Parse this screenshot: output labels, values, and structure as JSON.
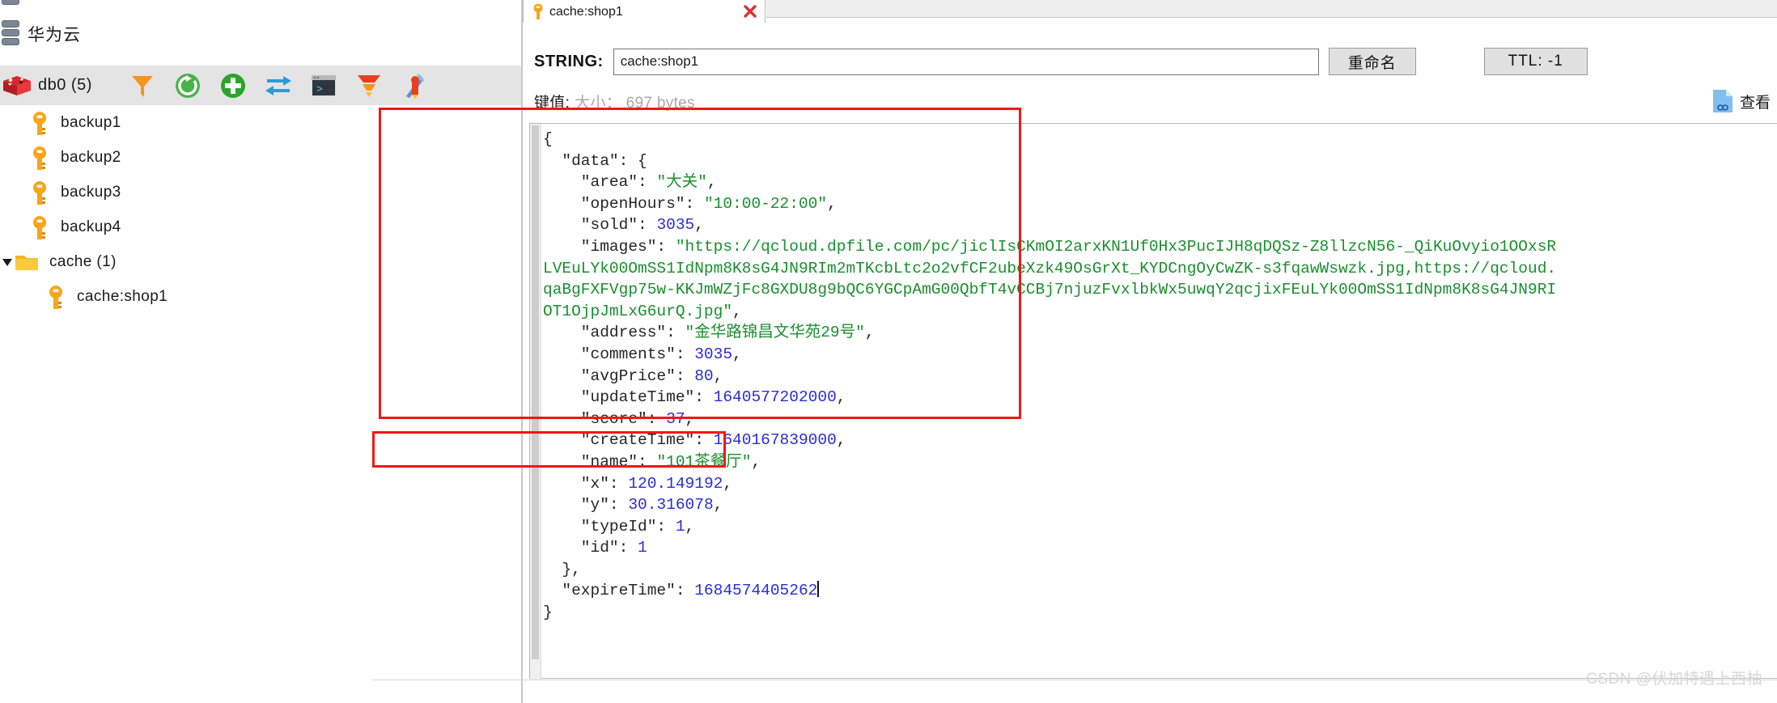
{
  "app": {
    "cloud_title": "华为云",
    "watermark": "CSDN @伏加特遇上西柚"
  },
  "sidebar": {
    "db_label": "db0 (5)",
    "db_icon": "redis-cube-icon",
    "toolbar_icons": [
      {
        "name": "filter-icon",
        "color": "#f7941e"
      },
      {
        "name": "refresh-icon",
        "color": "#3aa93a"
      },
      {
        "name": "add-icon",
        "color": "#2aa52a"
      },
      {
        "name": "switch-db-icon",
        "color": "#2e9bd6"
      },
      {
        "name": "console-icon",
        "color": "#2f3640"
      },
      {
        "name": "flush-icon",
        "color": "#e8401f"
      },
      {
        "name": "tools-icon",
        "color": "#e8401f"
      }
    ],
    "items": [
      {
        "label": "backup1",
        "icon": "key-icon",
        "type": "key",
        "indent": 1,
        "expanded": false
      },
      {
        "label": "backup2",
        "icon": "key-icon",
        "type": "key",
        "indent": 1,
        "expanded": false
      },
      {
        "label": "backup3",
        "icon": "key-icon",
        "type": "key",
        "indent": 1,
        "expanded": false
      },
      {
        "label": "backup4",
        "icon": "key-icon",
        "type": "key",
        "indent": 1,
        "expanded": false
      },
      {
        "label": "cache (1)",
        "icon": "folder-icon",
        "type": "folder",
        "indent": 0,
        "expanded": true
      },
      {
        "label": "cache:shop1",
        "icon": "key-icon",
        "type": "key",
        "indent": 2,
        "expanded": false
      }
    ]
  },
  "tab": {
    "label": "cache:shop1",
    "close_icon": "close-icon",
    "key_icon": "key-icon"
  },
  "toolbar": {
    "type_label": "STRING:",
    "key_value": "cache:shop1",
    "key_placeholder": "key",
    "rename_label": "重命名",
    "ttl_label": "TTL: -1"
  },
  "info": {
    "value_label": "键值:",
    "size_label": "大小： 697 bytes",
    "view_label": "查看",
    "view_icon": "document-link-icon"
  },
  "editor": {
    "caret_visible": true,
    "json_lines": [
      [
        {
          "t": "{",
          "c": "s-key"
        }
      ],
      [
        {
          "t": "  \"data\": {",
          "c": "s-key"
        }
      ],
      [
        {
          "t": "    \"area\": ",
          "c": "s-key"
        },
        {
          "t": "\"大关\"",
          "c": "s-str"
        },
        {
          "t": ",",
          "c": "s-key"
        }
      ],
      [
        {
          "t": "    \"openHours\": ",
          "c": "s-key"
        },
        {
          "t": "\"10:00-22:00\"",
          "c": "s-str"
        },
        {
          "t": ",",
          "c": "s-key"
        }
      ],
      [
        {
          "t": "    \"sold\": ",
          "c": "s-key"
        },
        {
          "t": "3035",
          "c": "s-num"
        },
        {
          "t": ",",
          "c": "s-key"
        }
      ],
      [
        {
          "t": "    \"images\": ",
          "c": "s-key"
        },
        {
          "t": "\"https://qcloud.dpfile.com/pc/jiclIsCKmOI2arxKN1Uf0Hx3PucIJH8qDQSz-Z8llzcN56-_QiKuOvyio1OOxsR",
          "c": "s-str"
        }
      ],
      [
        {
          "t": "LVEuLYk00OmSS1IdNpm8K8sG4JN9RIm2mTKcbLtc2o2vfCF2ubeXzk49OsGrXt_KYDCngOyCwZK-s3fqawWswzk.jpg,https://qcloud.",
          "c": "s-str"
        }
      ],
      [
        {
          "t": "qaBgFXFVgp75w-KKJmWZjFc8GXDU8g9bQC6YGCpAmG00QbfT4vCCBj7njuzFvxlbkWx5uwqY2qcjixFEuLYk00OmSS1IdNpm8K8sG4JN9RI",
          "c": "s-str"
        }
      ],
      [
        {
          "t": "OT1OjpJmLxG6urQ.jpg\"",
          "c": "s-str"
        },
        {
          "t": ",",
          "c": "s-key"
        }
      ],
      [
        {
          "t": "    \"address\": ",
          "c": "s-key"
        },
        {
          "t": "\"金华路锦昌文华苑29号\"",
          "c": "s-str"
        },
        {
          "t": ",",
          "c": "s-key"
        }
      ],
      [
        {
          "t": "    \"comments\": ",
          "c": "s-key"
        },
        {
          "t": "3035",
          "c": "s-num"
        },
        {
          "t": ",",
          "c": "s-key"
        }
      ],
      [
        {
          "t": "    \"avgPrice\": ",
          "c": "s-key"
        },
        {
          "t": "80",
          "c": "s-num"
        },
        {
          "t": ",",
          "c": "s-key"
        }
      ],
      [
        {
          "t": "    \"updateTime\": ",
          "c": "s-key"
        },
        {
          "t": "1640577202000",
          "c": "s-num"
        },
        {
          "t": ",",
          "c": "s-key"
        }
      ],
      [
        {
          "t": "    \"score\": ",
          "c": "s-key"
        },
        {
          "t": "37",
          "c": "s-num"
        },
        {
          "t": ",",
          "c": "s-key"
        }
      ],
      [
        {
          "t": "    \"createTime\": ",
          "c": "s-key"
        },
        {
          "t": "1640167839000",
          "c": "s-num"
        },
        {
          "t": ",",
          "c": "s-key"
        }
      ],
      [
        {
          "t": "    \"name\": ",
          "c": "s-key"
        },
        {
          "t": "\"101茶餐厅\"",
          "c": "s-str"
        },
        {
          "t": ",",
          "c": "s-key"
        }
      ],
      [
        {
          "t": "    \"x\": ",
          "c": "s-key"
        },
        {
          "t": "120.149192",
          "c": "s-num"
        },
        {
          "t": ",",
          "c": "s-key"
        }
      ],
      [
        {
          "t": "    \"y\": ",
          "c": "s-key"
        },
        {
          "t": "30.316078",
          "c": "s-num"
        },
        {
          "t": ",",
          "c": "s-key"
        }
      ],
      [
        {
          "t": "    \"typeId\": ",
          "c": "s-key"
        },
        {
          "t": "1",
          "c": "s-num"
        },
        {
          "t": ",",
          "c": "s-key"
        }
      ],
      [
        {
          "t": "    \"id\": ",
          "c": "s-key"
        },
        {
          "t": "1",
          "c": "s-num"
        }
      ],
      [
        {
          "t": "  },",
          "c": "s-key"
        }
      ],
      [
        {
          "t": "  \"expireTime\": ",
          "c": "s-key"
        },
        {
          "t": "1684574405262",
          "c": "s-num"
        },
        {
          "t": "|CARET|",
          "c": "caret"
        }
      ],
      [
        {
          "t": "}",
          "c": "s-key"
        }
      ]
    ]
  },
  "annotations": [
    {
      "name": "data-object-highlight",
      "color": "#f01818"
    },
    {
      "name": "expiretime-highlight",
      "color": "#f01818"
    }
  ]
}
